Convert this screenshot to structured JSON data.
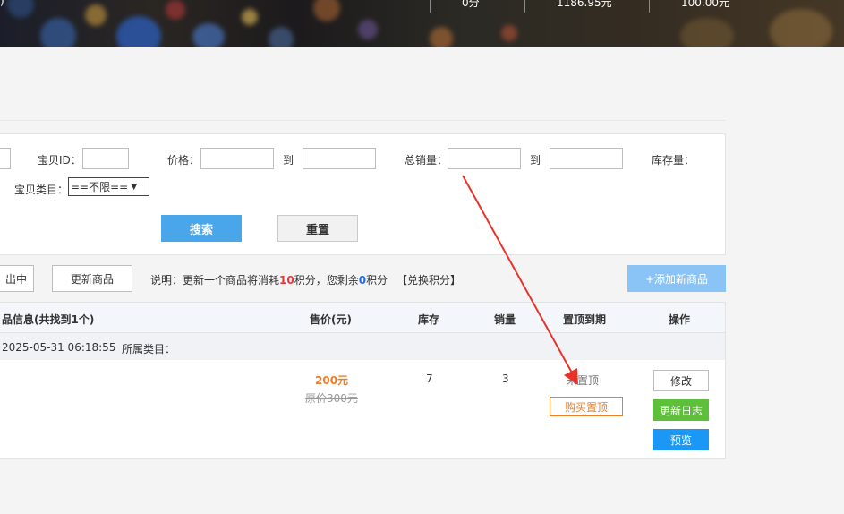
{
  "banner": {
    "stats": [
      "0分",
      "1186.95元",
      "100.00元"
    ],
    "left_glyph": ")"
  },
  "search": {
    "id_label": "宝贝ID：",
    "id_value": "",
    "price_label": "价格：",
    "to_label": "到",
    "sales_label": "总销量：",
    "stock_label": "库存量：",
    "category_label": "宝贝类目：",
    "category_selected": "==不限==",
    "search_button": "搜索",
    "reset_button": "重置"
  },
  "toolbar": {
    "partial_button": "出中",
    "update_button": "更新商品",
    "note_prefix": "说明：更新一个商品将消耗",
    "note_cost": "10",
    "note_mid": "积分，您剩余",
    "note_balance": "0",
    "note_unit": "积分",
    "note_link": "【兑换积分】",
    "add_button": "+添加新商品"
  },
  "table": {
    "headers": {
      "info": "品信息(共找到1个)",
      "price": "售价(元)",
      "stock": "库存",
      "sales": "销量",
      "top_expire": "置顶到期",
      "actions": "操作"
    },
    "rows": [
      {
        "time": "2025-05-31 06:18:55",
        "category_label": "所属类目：",
        "price": "200元",
        "original_price": "原价300元",
        "stock": "7",
        "sales": "3",
        "top_status": "未置顶",
        "buy_top_button": "购买置顶",
        "edit_button": "修改",
        "log_button": "更新日志",
        "preview_button": "预览"
      }
    ]
  },
  "colors": {
    "accent_blue": "#4aa6ea",
    "price_orange": "#f07d22",
    "arrow_red": "#e8332b",
    "log_green": "#5ebf3a",
    "preview_blue": "#1b98f5"
  }
}
